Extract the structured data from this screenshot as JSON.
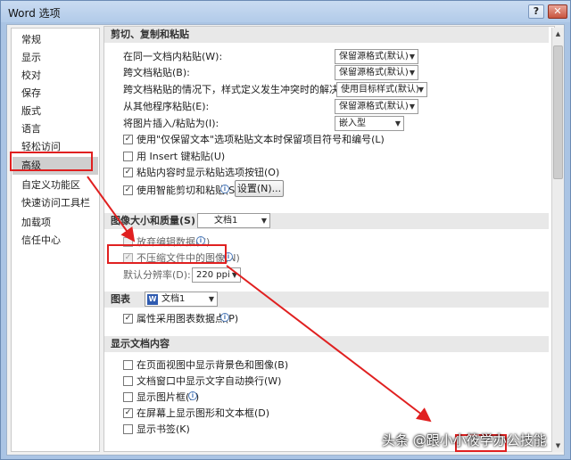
{
  "window": {
    "title": "Word 选项",
    "help_label": "?",
    "close_label": "✕"
  },
  "sidebar": {
    "items": [
      {
        "label": "常规"
      },
      {
        "label": "显示"
      },
      {
        "label": "校对"
      },
      {
        "label": "保存"
      },
      {
        "label": "版式"
      },
      {
        "label": "语言"
      },
      {
        "label": "轻松访问"
      },
      {
        "label": "高级"
      },
      {
        "label": "自定义功能区"
      },
      {
        "label": "快速访问工具栏"
      },
      {
        "label": "加载项"
      },
      {
        "label": "信任中心"
      }
    ],
    "selected": "高级"
  },
  "paste": {
    "heading": "剪切、复制和粘贴",
    "same_doc_label": "在同一文档内粘贴(W):",
    "same_doc_value": "保留源格式(默认)",
    "cross_doc_label": "跨文档粘贴(B):",
    "cross_doc_value": "保留源格式(默认)",
    "conflict_label": "跨文档粘贴的情况下，样式定义发生冲突时的解决方法(E):",
    "conflict_value": "使用目标样式(默认)",
    "other_prog_label": "从其他程序粘贴(E):",
    "other_prog_value": "保留源格式(默认)",
    "insert_pic_label": "将图片插入/粘贴为(I):",
    "insert_pic_value": "嵌入型",
    "keep_bullets_label": "使用\"仅保留文本\"选项粘贴文本时保留项目符号和编号(L)",
    "insert_key_label": "用 Insert 键粘贴(U)",
    "show_options_label": "粘贴内容时显示粘贴选项按钮(O)",
    "smart_cut_label": "使用智能剪切和粘贴(S)",
    "settings_button": "设置(N)..."
  },
  "image": {
    "heading": "图像大小和质量(S)",
    "doc_value": "文档1",
    "discard_label": "放弃编辑数据(C)",
    "no_compress_label": "不压缩文件中的图像(N)",
    "resolution_label": "默认分辨率(D):",
    "resolution_value": "220 ppi"
  },
  "chart": {
    "heading": "图表",
    "doc_value": "文档1",
    "properties_label": "属性采用图表数据点(P)"
  },
  "display": {
    "heading": "显示文档内容",
    "items": [
      {
        "label": "在页面视图中显示背景色和图像(B)"
      },
      {
        "label": "文档窗口中显示文字自动换行(W)"
      },
      {
        "label": "显示图片框(P)"
      },
      {
        "label": "在屏幕上显示图形和文本框(D)"
      },
      {
        "label": "显示书签(K)"
      }
    ]
  },
  "overlay": {
    "watermark": "头条 @跟小小筱学办公技能"
  },
  "colors": {
    "annotation": "#e02020",
    "selected_nav": "#cfcfcf",
    "section_bg": "#e8e8e8"
  }
}
